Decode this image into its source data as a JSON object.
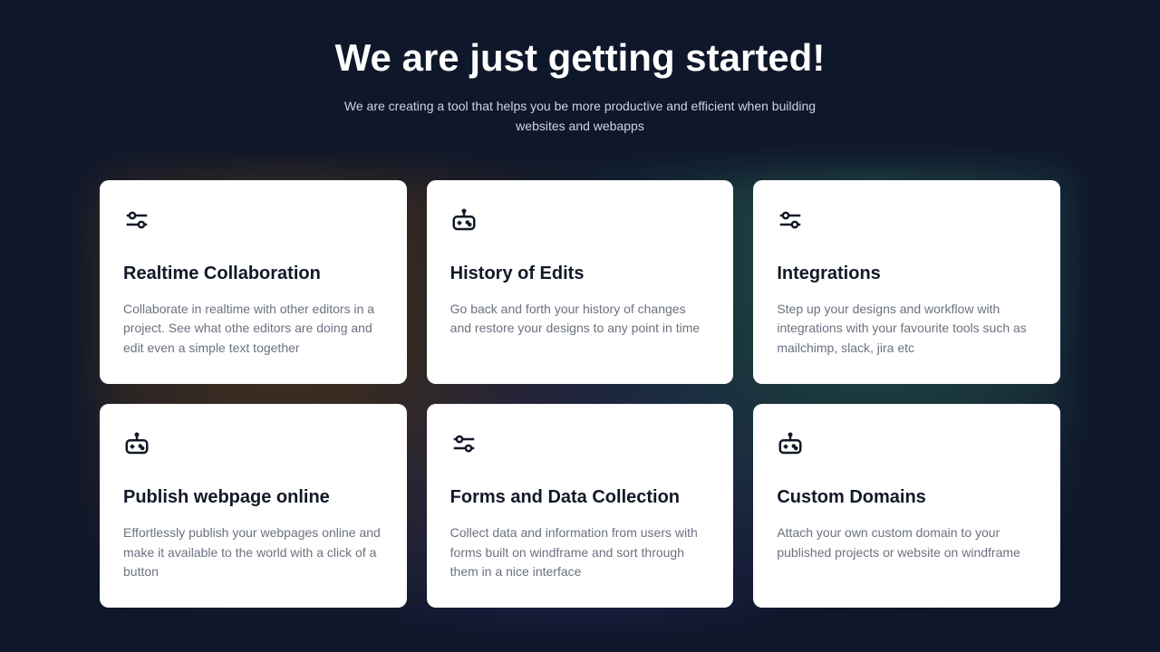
{
  "hero": {
    "title": "We are just getting started!",
    "subtitle": "We are creating a tool that helps you be more productive and efficient when building websites and webapps"
  },
  "cards": [
    {
      "icon": "sliders",
      "title": "Realtime Collaboration",
      "desc": "Collaborate in realtime with other editors in a project. See what othe editors are doing and edit even a simple text together"
    },
    {
      "icon": "gamepad",
      "title": "History of Edits",
      "desc": "Go back and forth your history of changes and restore your designs to any point in time"
    },
    {
      "icon": "sliders",
      "title": "Integrations",
      "desc": "Step up your designs and workflow with integrations with your favourite tools such as mailchimp, slack, jira etc"
    },
    {
      "icon": "gamepad",
      "title": "Publish webpage online",
      "desc": "Effortlessly publish your webpages online and make it available to the world with a click of a button"
    },
    {
      "icon": "sliders",
      "title": "Forms and Data Collection",
      "desc": "Collect data and information from users with forms built on windframe and sort through them in a nice interface"
    },
    {
      "icon": "gamepad",
      "title": "Custom Domains",
      "desc": "Attach your own custom domain to your published projects or website on windframe"
    }
  ]
}
